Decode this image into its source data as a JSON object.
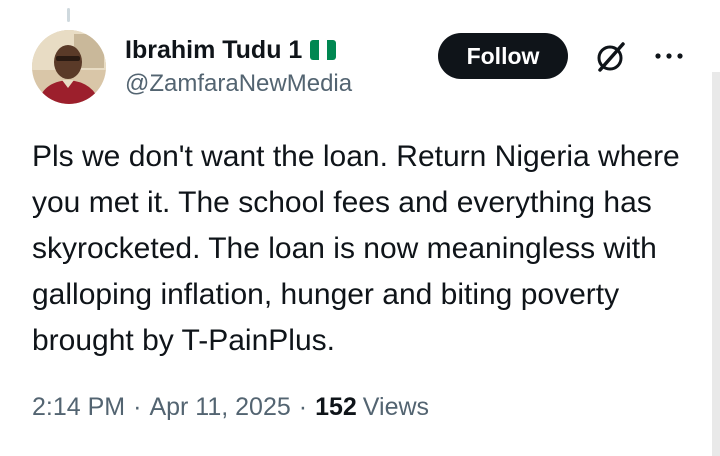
{
  "author": {
    "display_name": "Ibrahim Tudu 1",
    "handle": "@ZamfaraNewMedia",
    "flag_icon": "nigeria-flag-icon"
  },
  "actions": {
    "follow_label": "Follow",
    "grok_icon": "grok-icon",
    "more_icon": "more-horizontal-icon"
  },
  "tweet": {
    "text": "Pls we don't want the loan. Return Nigeria where you met it. The school fees and everything has skyrocketed. The loan is now meaningless with galloping inflation, hunger and biting poverty brought by T-PainPlus."
  },
  "meta": {
    "time": "2:14 PM",
    "separator": "·",
    "date": "Apr 11, 2025",
    "views_count": "152",
    "views_label": "Views"
  },
  "colors": {
    "text_primary": "#0f1419",
    "text_secondary": "#536471",
    "button_bg": "#0f1419",
    "flag_green": "#008751"
  }
}
